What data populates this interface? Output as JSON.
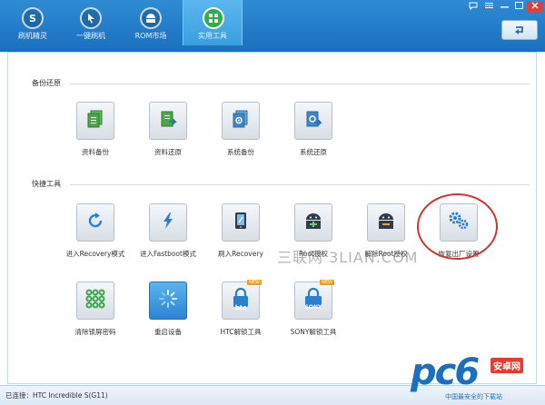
{
  "nav": {
    "tabs": [
      {
        "label": "刷机精灵",
        "icon": "logo-s-icon"
      },
      {
        "label": "一键刷机",
        "icon": "arrow-cursor-icon"
      },
      {
        "label": "ROM市场",
        "icon": "android-icon"
      },
      {
        "label": "实用工具",
        "icon": "grid-tools-icon",
        "active": true
      }
    ]
  },
  "window_controls": [
    "comment-icon",
    "menu-icon",
    "minimize-icon",
    "maximize-icon",
    "close-icon"
  ],
  "sections": {
    "backup": {
      "title": "备份还原",
      "items": [
        {
          "label": "资料备份",
          "icon": "data-backup-icon"
        },
        {
          "label": "资料还原",
          "icon": "data-restore-icon"
        },
        {
          "label": "系统备份",
          "icon": "system-backup-icon"
        },
        {
          "label": "系统还原",
          "icon": "system-restore-icon"
        }
      ]
    },
    "quick": {
      "title": "快捷工具",
      "items": [
        {
          "label": "进入Recovery模式",
          "icon": "refresh-icon"
        },
        {
          "label": "进入Fastboot模式",
          "icon": "lightning-icon"
        },
        {
          "label": "刷入Recovery",
          "icon": "tablet-icon"
        },
        {
          "label": "Root授权",
          "icon": "android-plus-icon"
        },
        {
          "label": "解除Root授权",
          "icon": "android-minus-icon"
        },
        {
          "label": "恢复出厂设置",
          "icon": "gears-icon"
        },
        {
          "label": "清除锁屏密码",
          "icon": "pattern-lock-icon"
        },
        {
          "label": "重启设备",
          "icon": "loading-icon"
        },
        {
          "label": "HTC解锁工具",
          "icon": "htc-lock-icon",
          "badge": "NEW",
          "brand": "htc"
        },
        {
          "label": "SONY解锁工具",
          "icon": "sony-lock-icon",
          "badge": "NEW",
          "brand": "SONY"
        }
      ]
    }
  },
  "status": {
    "text": "已连接：HTC Incredible S(G11)"
  },
  "watermark": {
    "text": "三联网 3LIAN.COM"
  },
  "brand": {
    "logo": "pc6",
    "name": "安卓网",
    "slogan": "中国最安全的下载站"
  },
  "colors": {
    "header": "#1f78c4",
    "accent": "#2a84d4",
    "highlight": "#d33232",
    "brand_blue": "#1b6fc1",
    "brand_red": "#e63b2e"
  }
}
